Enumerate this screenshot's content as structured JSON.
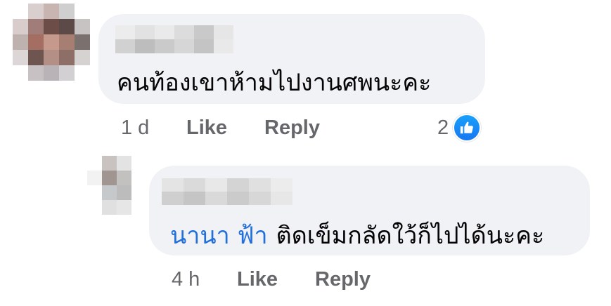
{
  "comment": {
    "text": "คนท้องเขาห้ามไปงานศพนะคะ",
    "time": "1 d",
    "like_label": "Like",
    "reply_label": "Reply",
    "reaction_count": "2",
    "reaction_icon": "thumbs-up-icon"
  },
  "reply": {
    "mention": "นานา ฟ้า",
    "text": "ติดเข็มกลัดใว้ก็ไปได้นะคะ",
    "time": "4 h",
    "like_label": "Like",
    "reply_label": "Reply"
  },
  "colors": {
    "bubble": "#f0f2f5",
    "mention": "#216fdb",
    "action": "#65676b",
    "like_badge": "#1877f2"
  }
}
